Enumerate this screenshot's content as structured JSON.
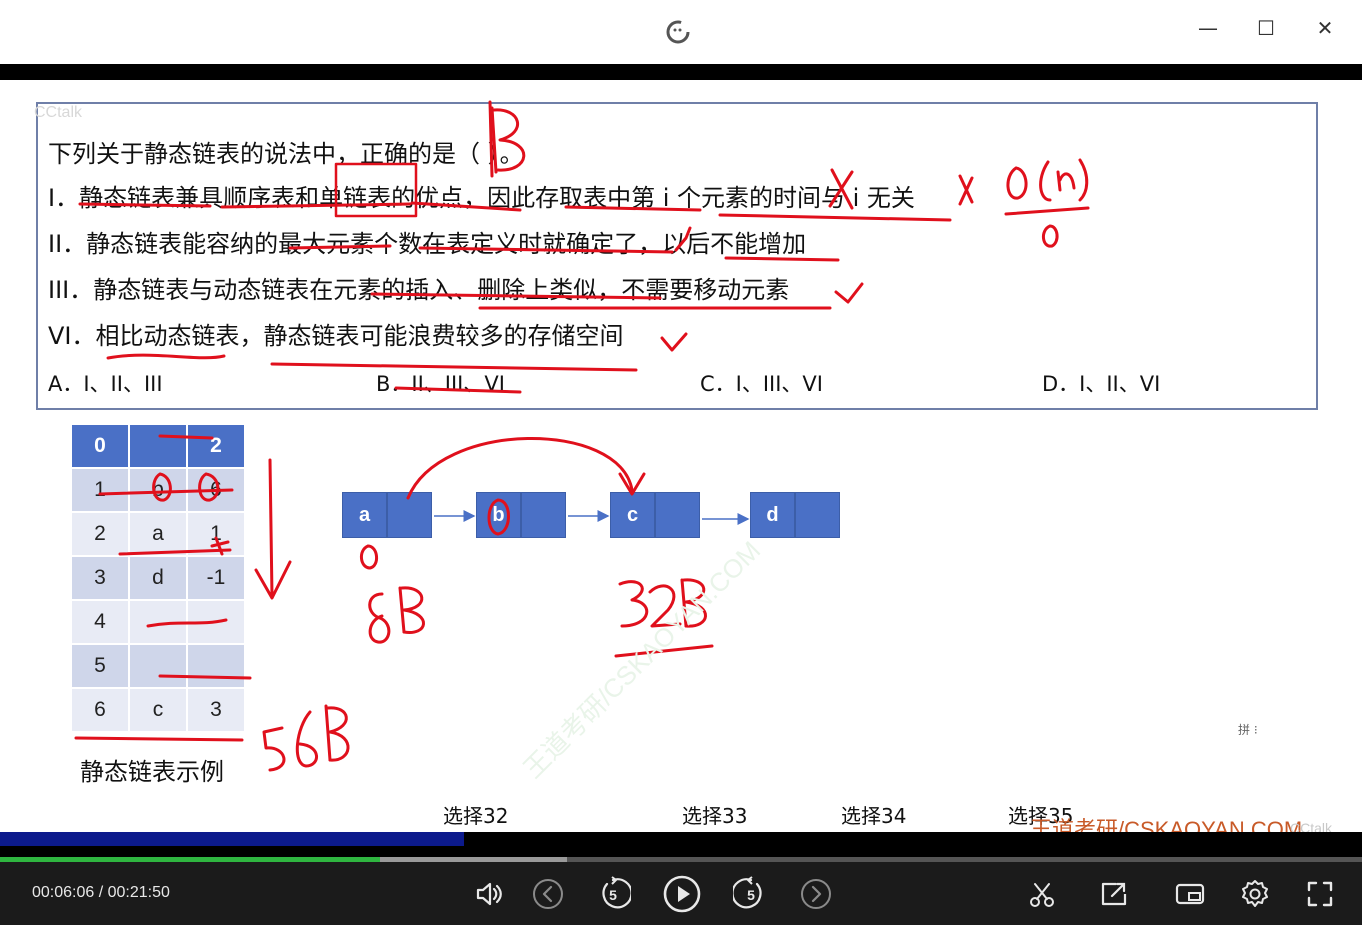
{
  "window": {
    "min_glyph": "—",
    "max_glyph": "☐",
    "close_glyph": "✕"
  },
  "slide": {
    "cctalk_watermark": "CCtalk",
    "question": {
      "title": "下列关于静态链表的说法中，正确的是（  ）。",
      "statements": [
        "I．静态链表兼具顺序表和单链表的优点，因此存取表中第 i 个元素的时间与 i 无关",
        "II．静态链表能容纳的最大元素个数在表定义时就确定了，以后不能增加",
        "III．静态链表与动态链表在元素的插入、删除上类似，不需要移动元素",
        "VI．相比动态链表，静态链表可能浪费较多的存储空间"
      ],
      "options": [
        "A．I、II、III",
        "B．II、III、VI",
        "C．I、III、VI",
        "D．I、II、VI"
      ]
    },
    "table": {
      "header": [
        "0",
        "",
        "2"
      ],
      "rows": [
        [
          "1",
          "b",
          "6"
        ],
        [
          "2",
          "a",
          "1"
        ],
        [
          "3",
          "d",
          "-1"
        ],
        [
          "4",
          "",
          ""
        ],
        [
          "5",
          "",
          ""
        ],
        [
          "6",
          "c",
          "3"
        ]
      ],
      "caption": "静态链表示例"
    },
    "nodes": [
      "a",
      "b",
      "c",
      "d"
    ],
    "handwriting": {
      "answer": "B",
      "complexity": "O(n)",
      "index_zero": "0",
      "size_small": "8B",
      "size_node": "32B",
      "size_table": "56B"
    },
    "mini_icons": "拼 ⁝"
  },
  "chapters": [
    "选择32",
    "选择33",
    "选择34",
    "选择35"
  ],
  "brand_watermark": "王道考研/CSKAOYAN.COM",
  "cctalk_watermark2": "CCtalk",
  "player": {
    "current_time": "00:06:06",
    "separator": " / ",
    "total_time": "00:21:50",
    "skip_seconds": "5",
    "progress_played_fraction": 0.279,
    "progress_buffered_fraction": 0.416
  },
  "colors": {
    "accent_blue": "#4a70c6",
    "ink_red": "#e0101c",
    "progress_green": "#2fb640"
  }
}
